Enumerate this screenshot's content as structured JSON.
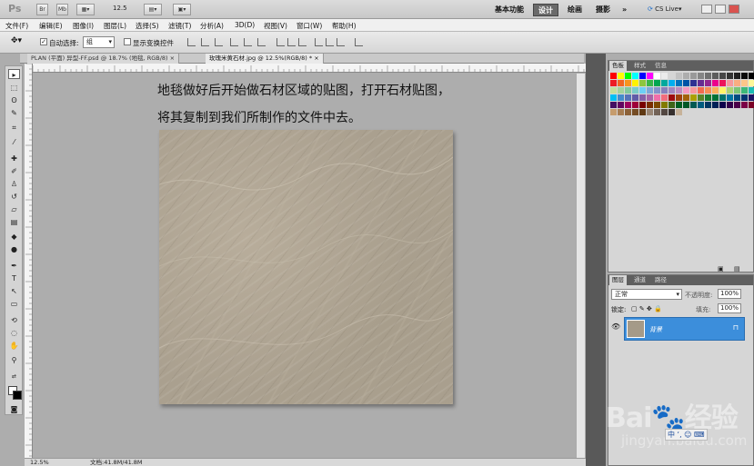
{
  "app": {
    "logo": "Ps",
    "zoom": "12.5",
    "buttons": [
      "Br",
      "Mb"
    ]
  },
  "workspaces": {
    "essentials": "基本功能",
    "design": "设计",
    "painting": "绘画",
    "photography": "摄影",
    "more": "»",
    "cslive": "CS Live"
  },
  "menu": [
    "文件(F)",
    "编辑(E)",
    "图像(I)",
    "图层(L)",
    "选择(S)",
    "滤镜(T)",
    "分析(A)",
    "3D(D)",
    "视图(V)",
    "窗口(W)",
    "帮助(H)"
  ],
  "options": {
    "autoselect_label": "自动选择:",
    "autoselect_value": "组",
    "transform_label": "显示变换控件"
  },
  "tabs": [
    {
      "label": "PLAN (平面) 异型-FF.psd @ 18.7% (地毯, RGB/8)",
      "close": "×"
    },
    {
      "label": "玫瑰米黄石材.jpg @ 12.5%(RGB/8) *",
      "close": "×"
    }
  ],
  "canvas": {
    "line1": "地毯做好后开始做石材区域的贴图，打开石材贴图，",
    "line2": "将其复制到我们所制作的文件中去。"
  },
  "status": {
    "zoom": "12.5%",
    "doc": "文档:41.8M/41.8M"
  },
  "swatches_panel": {
    "tabs": [
      "色板",
      "样式",
      "信息"
    ]
  },
  "layers_panel": {
    "tabs": [
      "图层",
      "通道",
      "路径"
    ],
    "blend_mode": "正常",
    "opacity_label": "不透明度:",
    "opacity_value": "100%",
    "lock_label": "锁定:",
    "fill_label": "填充:",
    "fill_value": "100%",
    "layer_name": "背景"
  },
  "watermark": {
    "brand": "Bai",
    "brand2": "经验",
    "url": "jingyan.baidu.com",
    "ime": "中 ‘, ☺ ⌨"
  },
  "colors": {
    "selection": "#3c8edb",
    "canvas_bg": "#adadad",
    "stone": "#aaa08f"
  },
  "swatch_colors": [
    "#ff0000",
    "#ffff00",
    "#00ff00",
    "#00ffff",
    "#0000ff",
    "#ff00ff",
    "#ffffff",
    "#ebebeb",
    "#d6d6d6",
    "#c2c2c2",
    "#adadad",
    "#999999",
    "#858585",
    "#707070",
    "#5c5c5c",
    "#474747",
    "#333333",
    "#1f1f1f",
    "#0a0a0a",
    "#000000",
    "#ed1c24",
    "#f26522",
    "#f7941d",
    "#fff200",
    "#8dc63f",
    "#39b54a",
    "#00a651",
    "#00a99d",
    "#00aeef",
    "#0072bc",
    "#0054a6",
    "#2e3192",
    "#662d91",
    "#92278f",
    "#ec008c",
    "#ed145b",
    "#f5989d",
    "#f9ad81",
    "#fdc689",
    "#fff799",
    "#c4df9b",
    "#a3d39c",
    "#82ca9c",
    "#7accc8",
    "#6dcff6",
    "#7da7d9",
    "#8393ca",
    "#8781bd",
    "#a187be",
    "#bd8cbf",
    "#f49ac1",
    "#f6989d",
    "#f26c4f",
    "#f68e56",
    "#fbaf5d",
    "#fff568",
    "#acd373",
    "#7cc576",
    "#3cb878",
    "#1cbbb4",
    "#00bff3",
    "#448ccb",
    "#5574b9",
    "#605ca8",
    "#8560a8",
    "#a864a8",
    "#f06eaa",
    "#f26d7d",
    "#9e0b0f",
    "#a0410d",
    "#a3620a",
    "#aba000",
    "#598527",
    "#197b30",
    "#007236",
    "#00746b",
    "#0076a3",
    "#004b80",
    "#003471",
    "#1b1464",
    "#440e62",
    "#630460",
    "#9e005d",
    "#9e0039",
    "#790000",
    "#7b2e00",
    "#7d4900",
    "#827b00",
    "#406618",
    "#005e20",
    "#005826",
    "#005952",
    "#005b7f",
    "#003663",
    "#002157",
    "#0d004c",
    "#32004b",
    "#4b0049",
    "#7b0046",
    "#7a0026",
    "#c69c6d",
    "#a67c52",
    "#8c6239",
    "#754c24",
    "#603913",
    "#998675",
    "#736357",
    "#534741",
    "#362f2d",
    "#c7b299"
  ]
}
